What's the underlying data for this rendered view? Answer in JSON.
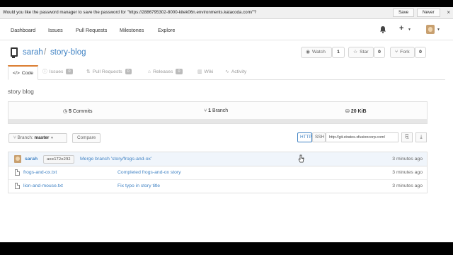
{
  "password_bar": {
    "message": "Would you like the password manager to save the password for \"https://2886795302-8000-kitek06n.environments.katacoda.com/\"?",
    "save_label": "Save",
    "never_label": "Never",
    "close_glyph": "×"
  },
  "topnav": {
    "links": [
      "Dashboard",
      "Issues",
      "Pull Requests",
      "Milestones",
      "Explore"
    ],
    "icons": [
      "bell-icon",
      "plus-icon",
      "avatar"
    ]
  },
  "repo": {
    "owner": "sarah",
    "separator": "/",
    "name": "story-blog",
    "watch_label": "Watch",
    "watch_count": "1",
    "star_label": "Star",
    "star_count": "0",
    "fork_label": "Fork",
    "fork_count": "0",
    "description": "story blog"
  },
  "tabs": [
    {
      "label": "Code",
      "icon": "code-icon",
      "active": true
    },
    {
      "label": "Issues",
      "icon": "issue-icon",
      "badge": "0"
    },
    {
      "label": "Pull Requests",
      "icon": "pull-request-icon",
      "badge": "0"
    },
    {
      "label": "Releases",
      "icon": "tag-icon",
      "badge": "0"
    },
    {
      "label": "Wiki",
      "icon": "book-icon"
    },
    {
      "label": "Activity",
      "icon": "pulse-icon"
    }
  ],
  "stats": {
    "commits_count": "5",
    "commits_label": "Commits",
    "branch_count": "1",
    "branch_label": "Branch",
    "size": "20 KiB"
  },
  "branch_bar": {
    "branch_prefix": "Branch:",
    "branch_name": "master",
    "compare_label": "Compare",
    "http_label": "HTTP",
    "ssh_label": "SSH",
    "clone_url": "http://git.stratos.xfusioncorp.com/"
  },
  "last_commit": {
    "author": "sarah",
    "sha": "aee172e292",
    "message": "Merge branch 'story/frogs-and-ox'",
    "time": "3 minutes ago"
  },
  "files": [
    {
      "name": "frogs-and-ox.txt",
      "message": "Completed frogs-and-ox story",
      "time": "3 minutes ago"
    },
    {
      "name": "lion-and-mouse.txt",
      "message": "Fix typo in story title",
      "time": "3 minutes ago"
    }
  ]
}
